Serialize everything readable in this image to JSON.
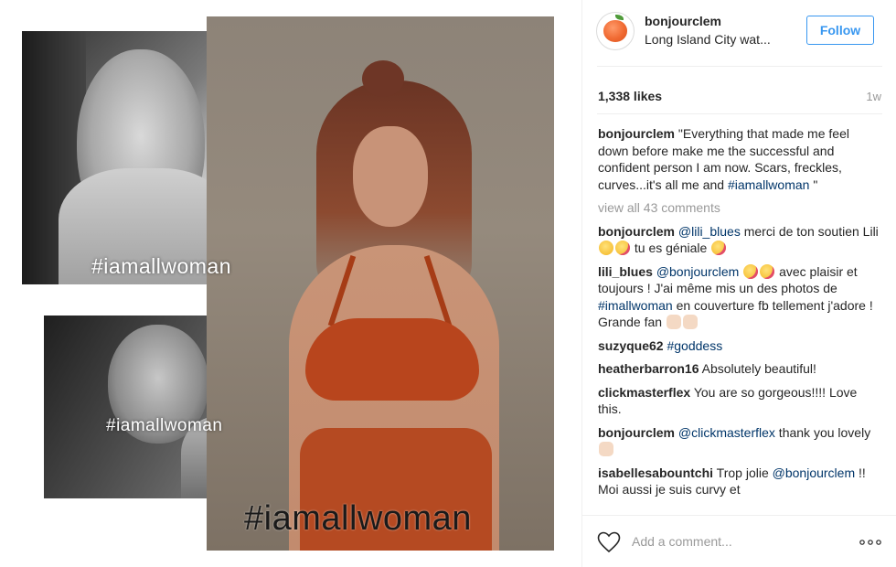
{
  "post": {
    "overlay_hashtag_top": "#iamallwoman",
    "overlay_hashtag_bottom": "#iamallwoman",
    "overlay_hashtag_main": "#iamallwoman"
  },
  "header": {
    "username": "bonjourclem",
    "location": "Long Island City wat...",
    "follow_label": "Follow",
    "avatar_icon": "apple-avatar-icon"
  },
  "stats": {
    "likes": "1,338 likes",
    "time_ago": "1w"
  },
  "caption": {
    "user": "bonjourclem",
    "text": "\"Everything that made me feel down before make me the successful and confident person I am now. Scars, freckles, curves...it's all me and ",
    "hashtag": "#iamallwoman",
    "text_end": " \""
  },
  "view_all": "view all 43 comments",
  "comments": [
    {
      "user": "bonjourclem",
      "mention": "@lili_blues",
      "text1": " merci de ton soutien Lili ",
      "text2": " tu es géniale "
    },
    {
      "user": "lili_blues",
      "mention": "@bonjourclem",
      "text1": " avec plaisir et toujours ! J'ai même mis un des photos de ",
      "hashtag": "#imallwoman",
      "text2": " en couverture fb tellement j'adore ! Grande fan "
    },
    {
      "user": "suzyque62",
      "hashtag": "#goddess"
    },
    {
      "user": "heatherbarron16",
      "text1": " Absolutely beautiful!"
    },
    {
      "user": "clickmasterflex",
      "text1": " You are so gorgeous!!!! Love this."
    },
    {
      "user": "bonjourclem",
      "mention": "@clickmasterflex",
      "text1": " thank you lovely "
    },
    {
      "user": "isabellesabountchi",
      "text1": " Trop jolie ",
      "mention": "@bonjourclem",
      "text2": " !! Moi aussi je suis curvy et"
    }
  ],
  "footer": {
    "comment_placeholder": "Add a comment...",
    "like_icon": "heart-icon",
    "more_icon": "more-options-icon"
  },
  "colors": {
    "link": "#003569",
    "follow_blue": "#3897f0",
    "muted": "#999999",
    "text": "#262626"
  }
}
